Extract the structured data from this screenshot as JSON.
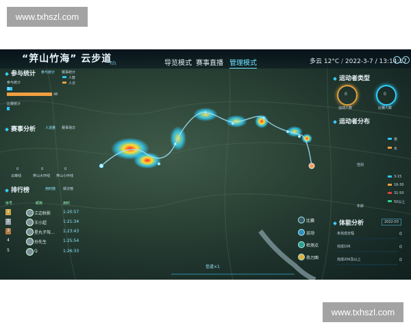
{
  "watermark": {
    "top": "www.txhszl.com",
    "bottom": "www.txhszl.com"
  },
  "header": {
    "title": "“笄山竹海” 云步道",
    "title_deco": "\\\\\\\\",
    "nav": [
      "导览模式",
      "赛事直播",
      "管理模式"
    ],
    "active_nav": "管理模式",
    "weather": "多云 12°C",
    "datetime": "2022-3-7 / 13:14:17"
  },
  "left": {
    "participation": {
      "title": "参与统计",
      "tab_a": "参与统计",
      "tab_b": "赛事统计",
      "sub_a": "参与统计",
      "legend": [
        "人数",
        "人次"
      ],
      "bar_values": [
        "5",
        "48"
      ],
      "sub_b": "比赛统计"
    },
    "event_analysis": {
      "title": "赛事分析",
      "tab_a": "人流量",
      "tab_b": "赛事场次",
      "stats": [
        {
          "value": "0",
          "label": "云峰线"
        },
        {
          "value": "0",
          "label": "笄山大环线"
        },
        {
          "value": "0",
          "label": "笄山小环线"
        }
      ]
    },
    "ranking": {
      "title": "排行榜",
      "tab_a": "用时榜",
      "tab_b": "频次榜",
      "headers": {
        "rank": "序号",
        "name": "昵称",
        "time": "用时"
      },
      "rows": [
        {
          "rank": "1",
          "name": "江边秋影",
          "time": "1:20:57"
        },
        {
          "rank": "2",
          "name": "王小超",
          "time": "1:21:34"
        },
        {
          "rank": "3",
          "name": "星丸子驾…",
          "time": "1:23:43"
        },
        {
          "rank": "4",
          "name": "孙先生",
          "time": "1:25:54"
        },
        {
          "rank": "5",
          "name": "Q",
          "time": "1:26:33"
        }
      ]
    }
  },
  "map": {
    "controls": [
      "比赛",
      "运动",
      "检测点",
      "热力图"
    ],
    "bottom_label": "信道×1"
  },
  "right": {
    "athlete_type": {
      "title": "运动者类型",
      "gauges": [
        {
          "value": "0",
          "label": "运动人数"
        },
        {
          "value": "0",
          "label": "比赛人数"
        }
      ]
    },
    "athlete_dist": {
      "title": "运动者分布",
      "gender_legend": [
        "男",
        "女"
      ],
      "axis_label": "性别",
      "age_legend": [
        "3-15",
        "16-30",
        "31-50",
        "50以上"
      ],
      "age_label": "年龄"
    },
    "fitness": {
      "title": "体能分析",
      "date": "2022-03",
      "items": [
        {
          "label": "未完成全程",
          "value": "0"
        },
        {
          "label": "完成10K",
          "value": "0"
        },
        {
          "label": "完成20K及以上",
          "value": "0"
        }
      ]
    }
  },
  "colors": {
    "accent": "#3ad0ff",
    "orange": "#f0a040",
    "heat_hot": "#ff3030",
    "heat_mid": "#ffe040",
    "heat_cool": "#2fd0ff"
  }
}
